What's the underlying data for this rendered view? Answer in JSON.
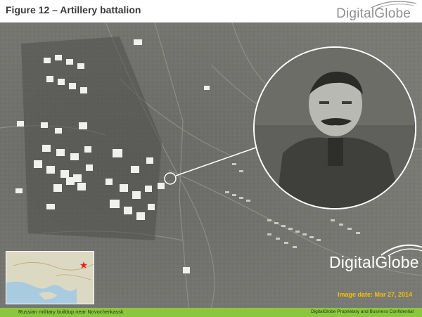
{
  "header": {
    "title": "Figure 12 – Artillery battalion",
    "brand": "DigitalGlobe"
  },
  "overlay": {
    "brand": "DigitalGlobe",
    "image_date": "Image date: Mar 27, 2014"
  },
  "footer": {
    "caption": "Russian military buildup near Novocherkassk",
    "confidentiality": "DigitalGlobe Proprietary and Business Confidential"
  },
  "inset_map": {
    "marker": "star-icon",
    "marker_color": "#e2231a"
  },
  "colors": {
    "footer_bar": "#8cc63f",
    "date_text": "#f2c200",
    "title_text": "#3a3a3a",
    "brand_gray": "#8f8f8f"
  }
}
